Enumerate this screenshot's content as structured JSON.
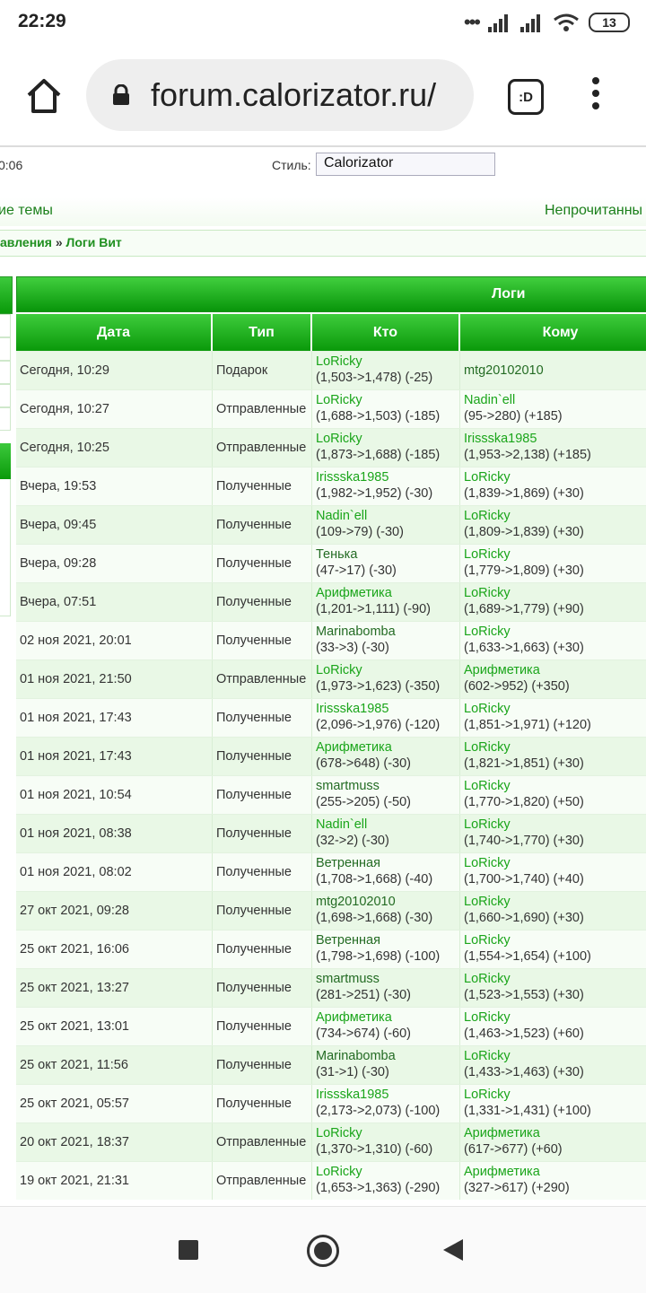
{
  "status_bar": {
    "time": "22:29",
    "battery": "13"
  },
  "browser": {
    "url": "forum.calorizator.ru/",
    "tab_count_label": ":D"
  },
  "page_header": {
    "time_fragment": "0:06",
    "style_label": "Стиль:",
    "style_value": "Calorizator",
    "nav_left": "ие темы",
    "nav_right": "Непрочитанны"
  },
  "breadcrumb": {
    "parent": "авления",
    "separator": "»",
    "current": "Логи Вит"
  },
  "logs": {
    "title": "Логи",
    "columns": [
      "Дата",
      "Тип",
      "Кто",
      "Кому"
    ],
    "rows": [
      {
        "date": "Сегодня, 10:29",
        "type": "Подарок",
        "who": "LoRicky",
        "who_val": "(1,503->1,478) (-25)",
        "to": "mtg20102010",
        "to_val": ""
      },
      {
        "date": "Сегодня, 10:27",
        "type": "Отправленные",
        "who": "LoRicky",
        "who_val": "(1,688->1,503) (-185)",
        "to": "Nadin`ell",
        "to_val": "(95->280) (+185)"
      },
      {
        "date": "Сегодня, 10:25",
        "type": "Отправленные",
        "who": "LoRicky",
        "who_val": "(1,873->1,688) (-185)",
        "to": "Irissska1985",
        "to_val": "(1,953->2,138) (+185)"
      },
      {
        "date": "Вчера, 19:53",
        "type": "Полученные",
        "who": "Irissska1985",
        "who_val": "(1,982->1,952) (-30)",
        "to": "LoRicky",
        "to_val": "(1,839->1,869) (+30)"
      },
      {
        "date": "Вчера, 09:45",
        "type": "Полученные",
        "who": "Nadin`ell",
        "who_val": "(109->79) (-30)",
        "to": "LoRicky",
        "to_val": "(1,809->1,839) (+30)"
      },
      {
        "date": "Вчера, 09:28",
        "type": "Полученные",
        "who": "Тенька",
        "who_val": "(47->17) (-30)",
        "to": "LoRicky",
        "to_val": "(1,779->1,809) (+30)"
      },
      {
        "date": "Вчера, 07:51",
        "type": "Полученные",
        "who": "Арифметика",
        "who_val": "(1,201->1,111) (-90)",
        "to": "LoRicky",
        "to_val": "(1,689->1,779) (+90)"
      },
      {
        "date": "02 ноя 2021, 20:01",
        "type": "Полученные",
        "who": "Marinabomba",
        "who_val": "(33->3) (-30)",
        "to": "LoRicky",
        "to_val": "(1,633->1,663) (+30)"
      },
      {
        "date": "01 ноя 2021, 21:50",
        "type": "Отправленные",
        "who": "LoRicky",
        "who_val": "(1,973->1,623) (-350)",
        "to": "Арифметика",
        "to_val": "(602->952) (+350)"
      },
      {
        "date": "01 ноя 2021, 17:43",
        "type": "Полученные",
        "who": "Irissska1985",
        "who_val": "(2,096->1,976) (-120)",
        "to": "LoRicky",
        "to_val": "(1,851->1,971) (+120)"
      },
      {
        "date": "01 ноя 2021, 17:43",
        "type": "Полученные",
        "who": "Арифметика",
        "who_val": "(678->648) (-30)",
        "to": "LoRicky",
        "to_val": "(1,821->1,851) (+30)"
      },
      {
        "date": "01 ноя 2021, 10:54",
        "type": "Полученные",
        "who": "smartmuss",
        "who_val": "(255->205) (-50)",
        "to": "LoRicky",
        "to_val": "(1,770->1,820) (+50)"
      },
      {
        "date": "01 ноя 2021, 08:38",
        "type": "Полученные",
        "who": "Nadin`ell",
        "who_val": "(32->2) (-30)",
        "to": "LoRicky",
        "to_val": "(1,740->1,770) (+30)"
      },
      {
        "date": "01 ноя 2021, 08:02",
        "type": "Полученные",
        "who": "Ветренная",
        "who_val": "(1,708->1,668) (-40)",
        "to": "LoRicky",
        "to_val": "(1,700->1,740) (+40)"
      },
      {
        "date": "27 окт 2021, 09:28",
        "type": "Полученные",
        "who": "mtg20102010",
        "who_val": "(1,698->1,668) (-30)",
        "to": "LoRicky",
        "to_val": "(1,660->1,690) (+30)"
      },
      {
        "date": "25 окт 2021, 16:06",
        "type": "Полученные",
        "who": "Ветренная",
        "who_val": "(1,798->1,698) (-100)",
        "to": "LoRicky",
        "to_val": "(1,554->1,654) (+100)"
      },
      {
        "date": "25 окт 2021, 13:27",
        "type": "Полученные",
        "who": "smartmuss",
        "who_val": "(281->251) (-30)",
        "to": "LoRicky",
        "to_val": "(1,523->1,553) (+30)"
      },
      {
        "date": "25 окт 2021, 13:01",
        "type": "Полученные",
        "who": "Арифметика",
        "who_val": "(734->674) (-60)",
        "to": "LoRicky",
        "to_val": "(1,463->1,523) (+60)"
      },
      {
        "date": "25 окт 2021, 11:56",
        "type": "Полученные",
        "who": "Marinabomba",
        "who_val": "(31->1) (-30)",
        "to": "LoRicky",
        "to_val": "(1,433->1,463) (+30)"
      },
      {
        "date": "25 окт 2021, 05:57",
        "type": "Полученные",
        "who": "Irissska1985",
        "who_val": "(2,173->2,073) (-100)",
        "to": "LoRicky",
        "to_val": "(1,331->1,431) (+100)"
      },
      {
        "date": "20 окт 2021, 18:37",
        "type": "Отправленные",
        "who": "LoRicky",
        "who_val": "(1,370->1,310) (-60)",
        "to": "Арифметика",
        "to_val": "(617->677) (+60)"
      },
      {
        "date": "19 окт 2021, 21:31",
        "type": "Отправленные",
        "who": "LoRicky",
        "who_val": "(1,653->1,363) (-290)",
        "to": "Арифметика",
        "to_val": "(327->617) (+290)"
      }
    ]
  },
  "colors": {
    "accent_green": "#0a990a",
    "link_green": "#1aa51a",
    "row_alt": "#e9f8e6"
  }
}
